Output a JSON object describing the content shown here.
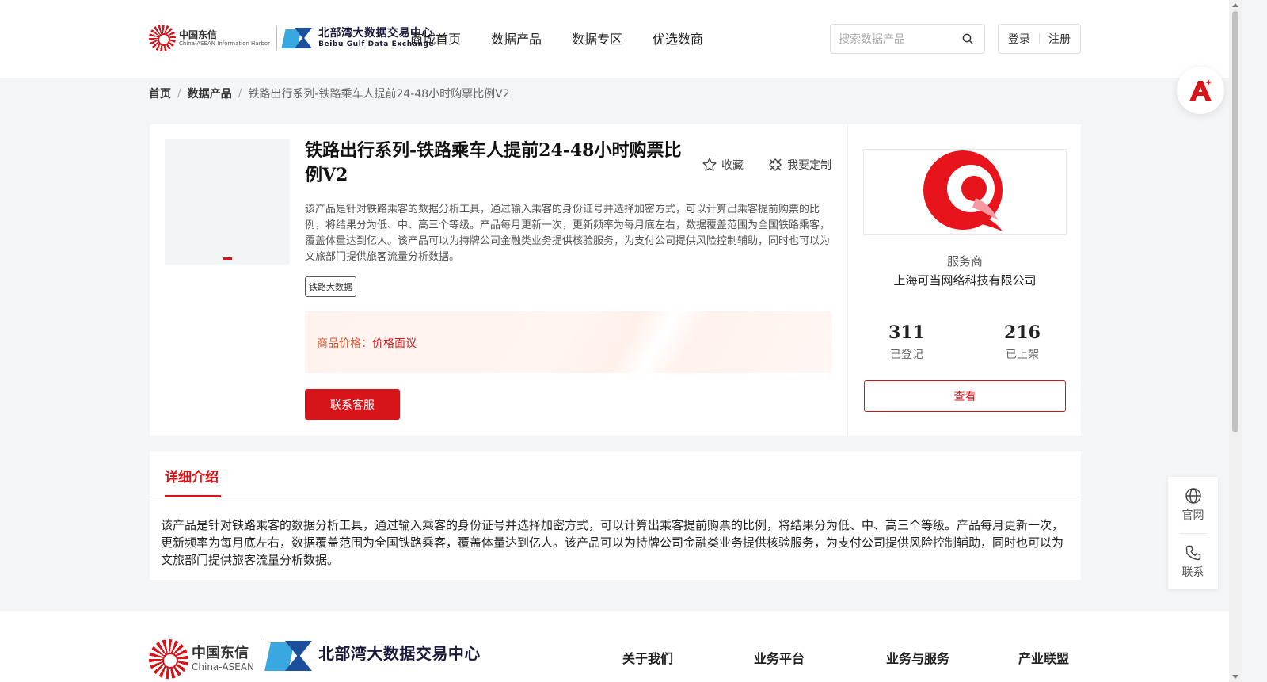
{
  "header": {
    "logo_primary_cn": "中国东信",
    "logo_primary_en": "China-ASEAN Information Harbor",
    "logo_secondary_cn": "北部湾大数据交易中心",
    "logo_secondary_en": "Beibu Gulf Data Exchange",
    "nav": [
      "商城首页",
      "数据产品",
      "数据专区",
      "优选数商"
    ],
    "search_placeholder": "搜索数据产品",
    "login_label": "登录",
    "register_label": "注册"
  },
  "breadcrumb": {
    "home": "首页",
    "category": "数据产品",
    "current": "铁路出行系列-铁路乘车人提前24-48小时购票比例V2",
    "separator": "/"
  },
  "product": {
    "title": "铁路出行系列-铁路乘车人提前24-48小时购票比例V2",
    "favorite_label": "收藏",
    "customize_label": "我要定制",
    "description": "该产品是针对铁路乘客的数据分析工具，通过输入乘客的身份证号并选择加密方式，可以计算出乘客提前购票的比例，将结果分为低、中、高三个等级。产品每月更新一次，更新频率为每月底左右，数据覆盖范围为全国铁路乘客，覆盖体量达到亿人。该产品可以为持牌公司金融类业务提供核验服务，为支付公司提供风险控制辅助，同时也可以为文旅部门提供旅客流量分析数据。",
    "tag": "铁路大数据",
    "price_label": "商品价格：",
    "price_value": "价格面议",
    "contact_button": "联系客服"
  },
  "vendor": {
    "role": "服务商",
    "name": "上海可当网络科技有限公司",
    "registered_count": "311",
    "registered_label": "已登记",
    "listed_count": "216",
    "listed_label": "已上架",
    "view_button": "查看"
  },
  "detail": {
    "tab_label": "详细介绍",
    "body": "该产品是针对铁路乘客的数据分析工具，通过输入乘客的身份证号并选择加密方式，可以计算出乘客提前购票的比例，将结果分为低、中、高三个等级。产品每月更新一次，更新频率为每月底左右，数据覆盖范围为全国铁路乘客，覆盖体量达到亿人。该产品可以为持牌公司金融类业务提供核验服务，为支付公司提供风险控制辅助，同时也可以为文旅部门提供旅客流量分析数据。"
  },
  "side_float": {
    "website_label": "官网",
    "contact_label": "联系"
  },
  "footer": {
    "logo_primary_cn": "中国东信",
    "logo_primary_en": "China-ASEAN",
    "logo_secondary_cn": "北部湾大数据交易中心",
    "nav": [
      "关于我们",
      "业务平台",
      "业务与服务",
      "产业联盟"
    ]
  },
  "colors": {
    "brand_red": "#d7141a",
    "price_orange": "#e2542e"
  }
}
